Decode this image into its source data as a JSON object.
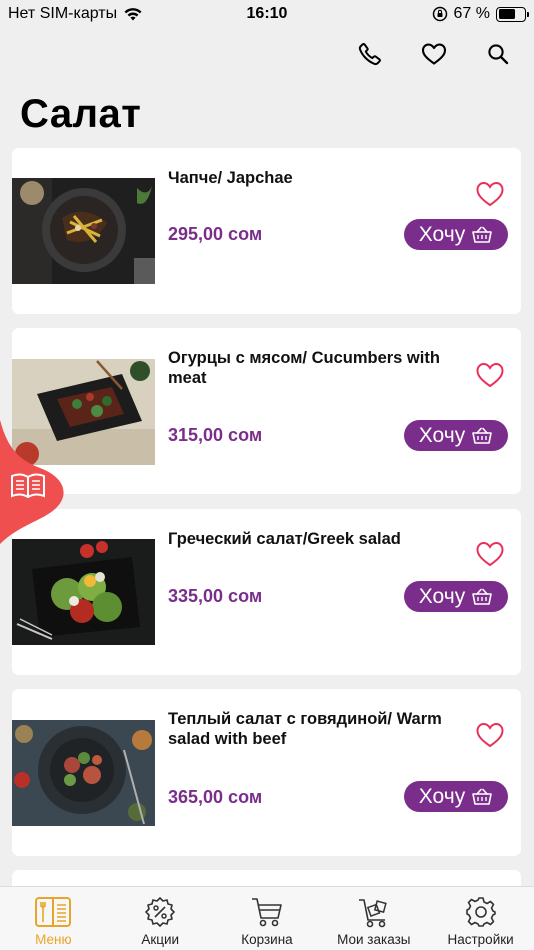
{
  "status_bar": {
    "carrier": "Нет SIM-карты",
    "time": "16:10",
    "battery": "67 %",
    "battery_level": 0.67
  },
  "page": {
    "title": "Салат"
  },
  "header_icons": [
    "phone-icon",
    "heart-icon",
    "search-icon"
  ],
  "products": [
    {
      "name": "Чапче/ Japchae",
      "price": "295,00 сом",
      "button": "Хочу"
    },
    {
      "name": "Огурцы с мясом/ Cucumbers with meat",
      "price": "315,00 сом",
      "button": "Хочу"
    },
    {
      "name": "Греческий салат/Greek salad",
      "price": "335,00 сом",
      "button": "Хочу"
    },
    {
      "name": "Теплый салат с говядиной/ Warm salad with beef",
      "price": "365,00 сом",
      "button": "Хочу"
    }
  ],
  "tabs": [
    {
      "label": "Меню",
      "icon": "menu-book-icon",
      "active": true
    },
    {
      "label": "Акции",
      "icon": "discount-gear-icon",
      "active": false
    },
    {
      "label": "Корзина",
      "icon": "cart-icon",
      "active": false
    },
    {
      "label": "Мои заказы",
      "icon": "orders-cart-icon",
      "active": false
    },
    {
      "label": "Настройки",
      "icon": "settings-gear-icon",
      "active": false
    }
  ],
  "colors": {
    "accent": "#7a2d8a",
    "favorite": "#e8305a",
    "active_tab": "#e8a52a",
    "side_tab": "#ef4f4f"
  }
}
